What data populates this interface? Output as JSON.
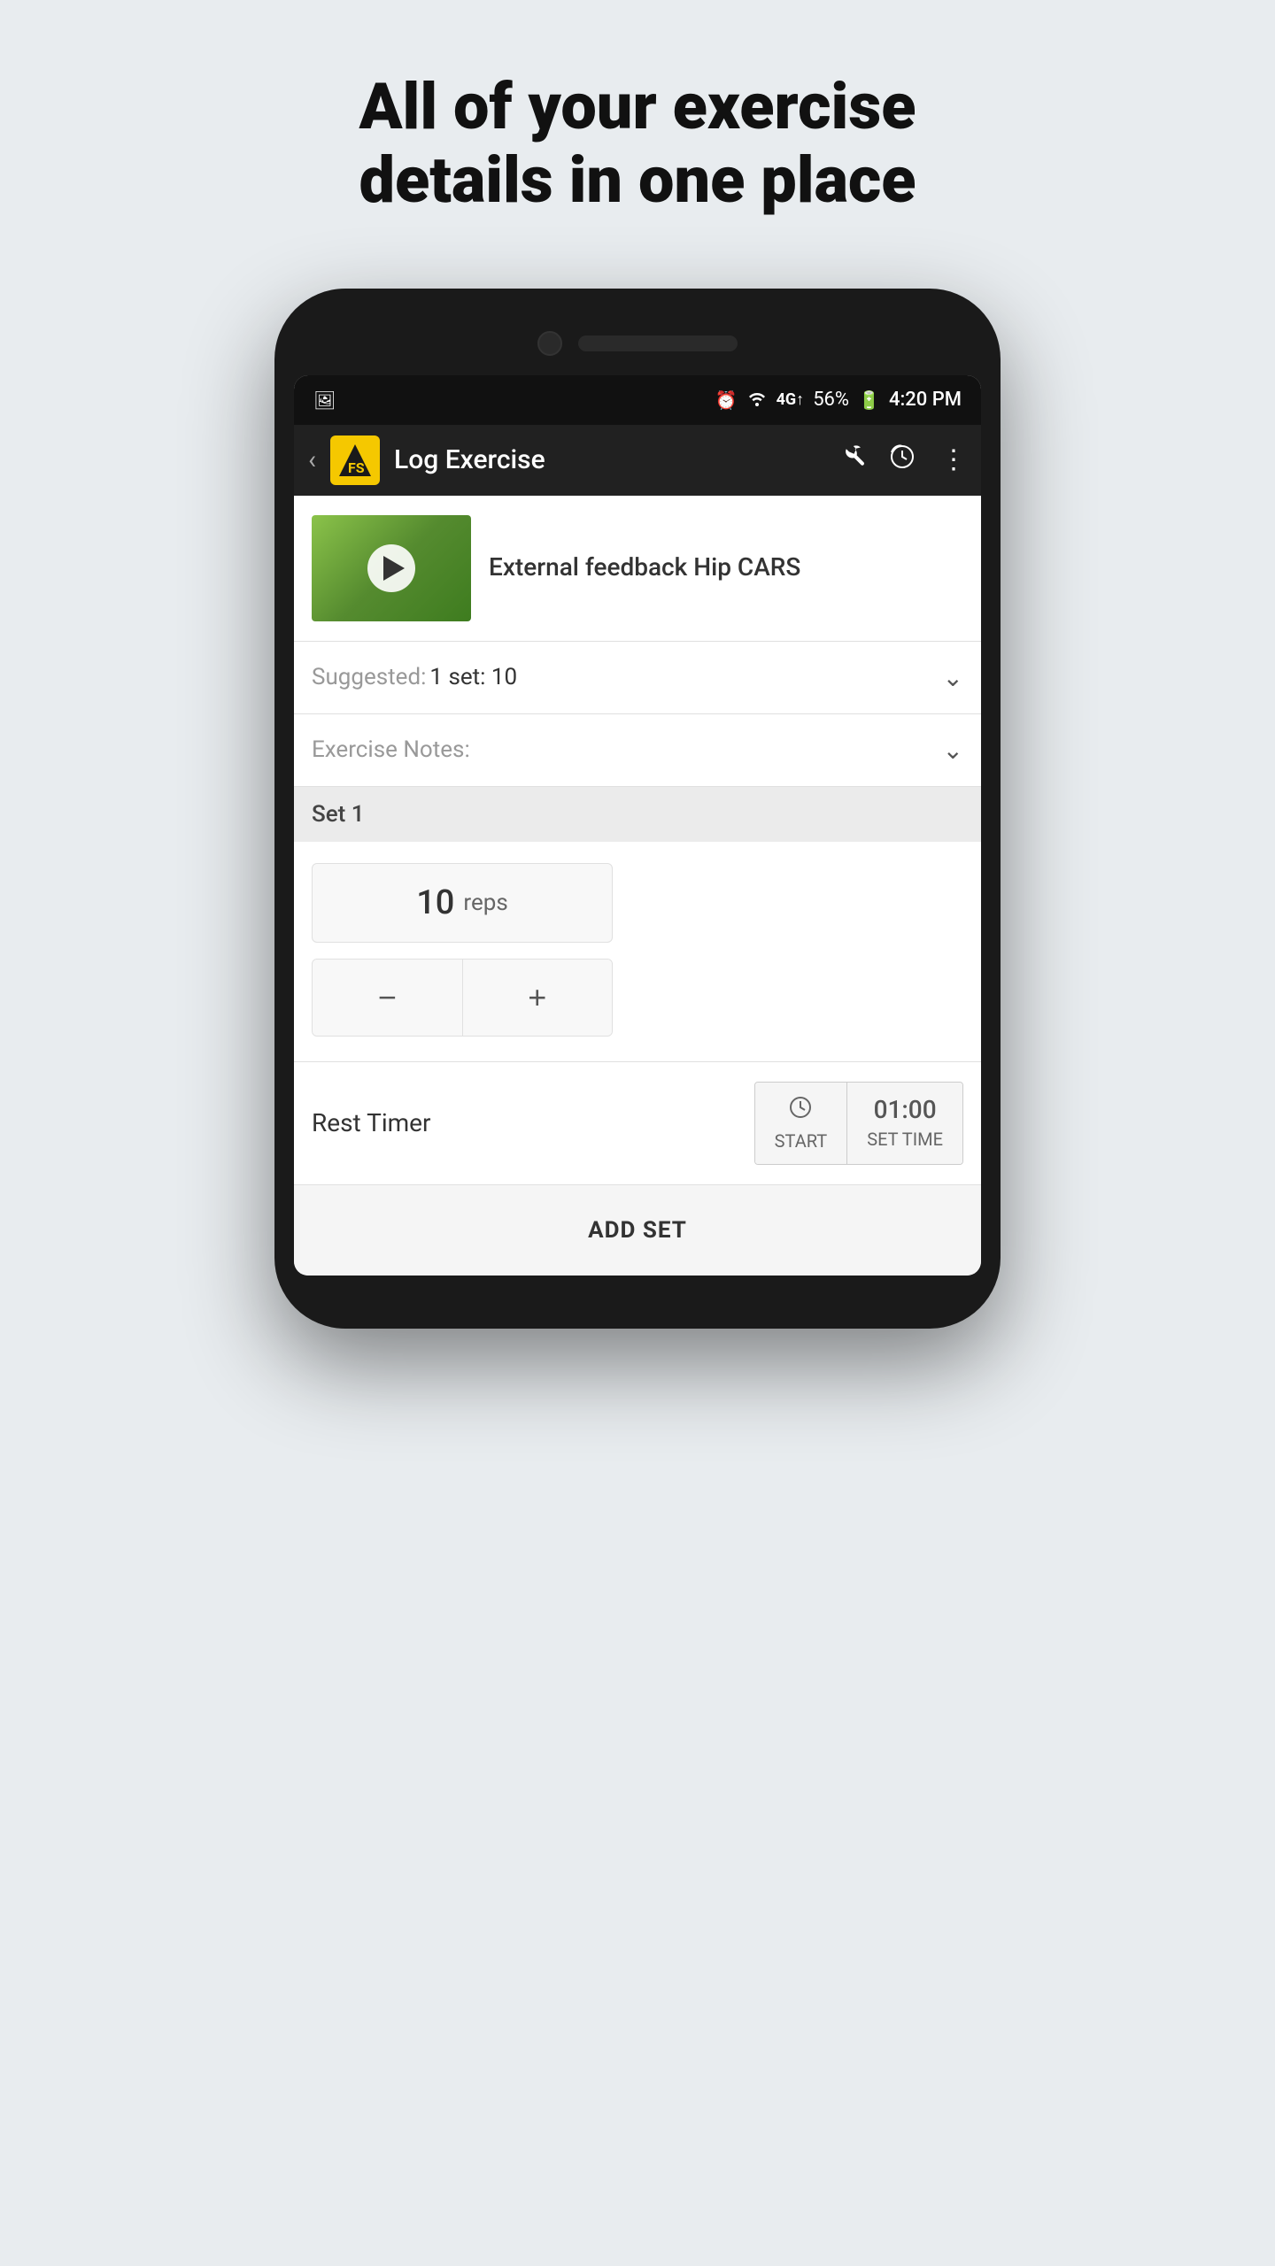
{
  "page": {
    "heading": "All of your exercise details in one place"
  },
  "status_bar": {
    "alarm_icon": "⏰",
    "wifi_icon": "WiFi",
    "signal_icon": "4G",
    "battery_percent": "56%",
    "battery_icon": "🔋",
    "time": "4:20 PM"
  },
  "app_bar": {
    "back_icon": "‹",
    "logo_text": "FS",
    "title": "Log Exercise",
    "wrench_icon": "🔧",
    "history_icon": "🕐",
    "more_icon": "⋮"
  },
  "exercise": {
    "name": "External feedback Hip CARS"
  },
  "suggested": {
    "label": "Suggested:",
    "value": "1 set: 10"
  },
  "exercise_notes": {
    "label": "Exercise Notes:"
  },
  "set_section": {
    "title": "Set 1"
  },
  "reps": {
    "value": "10",
    "unit": "reps",
    "decrement_label": "−",
    "increment_label": "+"
  },
  "rest_timer": {
    "label": "Rest Timer",
    "start_label": "START",
    "set_time_label": "SET TIME",
    "time_value": "01:00"
  },
  "add_set": {
    "label": "ADD SET"
  }
}
